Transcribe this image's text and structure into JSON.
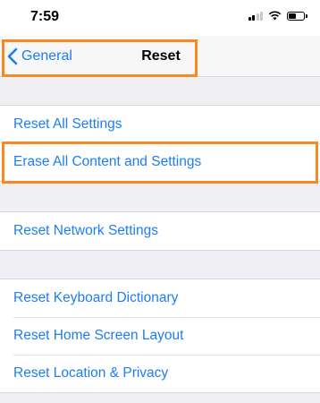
{
  "status_bar": {
    "time": "7:59"
  },
  "nav": {
    "back_label": "General",
    "title": "Reset"
  },
  "groups": [
    {
      "items": [
        {
          "label": "Reset All Settings"
        },
        {
          "label": "Erase All Content and Settings"
        }
      ]
    },
    {
      "items": [
        {
          "label": "Reset Network Settings"
        }
      ]
    },
    {
      "items": [
        {
          "label": "Reset Keyboard Dictionary"
        },
        {
          "label": "Reset Home Screen Layout"
        },
        {
          "label": "Reset Location & Privacy"
        }
      ]
    }
  ],
  "colors": {
    "accent": "#1e7df2",
    "highlight": "#f58a22",
    "background": "#efeff4"
  },
  "icons": {
    "back": "chevron-left-icon",
    "signal": "cellular-signal-icon",
    "wifi": "wifi-icon",
    "battery": "battery-icon"
  }
}
